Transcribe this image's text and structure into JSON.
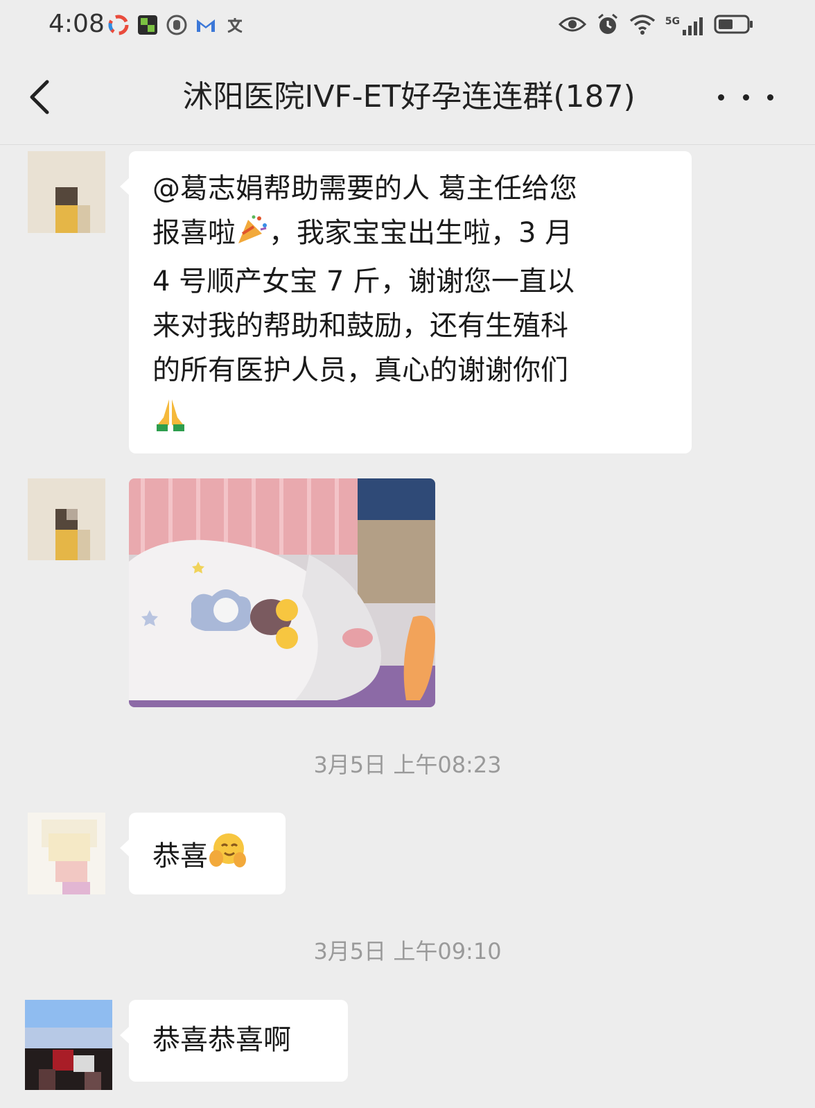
{
  "status_bar": {
    "time": "4:08",
    "left_icons": [
      "cloud-sync-icon",
      "app-green-icon",
      "shield-app-icon",
      "gmail-icon",
      "translate-icon"
    ],
    "right_icons": [
      "eye-icon",
      "alarm-icon",
      "wifi-icon",
      "signal-5g-icon",
      "battery-icon"
    ],
    "network_label": "5G"
  },
  "nav": {
    "title": "沭阳医院IVF-ET好孕连连群(187)",
    "back_icon": "chevron-left-icon",
    "more_icon": "more-icon"
  },
  "messages": [
    {
      "type": "text",
      "lines": [
        "@葛志娟帮助需要的人  葛主任给您",
        "报喜啦",
        "，我家宝宝出生啦，3 月",
        "4 号顺产女宝 7 斤，谢谢您一直以",
        "来对我的帮助和鼓励，还有生殖科",
        "的所有医护人员，真心的谢谢你们"
      ],
      "emojis": [
        "party-popper-icon",
        "folded-hands-icon"
      ]
    },
    {
      "type": "image",
      "description_icon": "baby-photo"
    },
    {
      "type": "timestamp",
      "text": "3月5日 上午08:23"
    },
    {
      "type": "text",
      "text": "恭喜",
      "emoji": "hugging-face-icon"
    },
    {
      "type": "timestamp",
      "text": "3月5日 上午09:10"
    },
    {
      "type": "text",
      "text": "恭喜恭喜啊"
    }
  ],
  "colors": {
    "background": "#ededed",
    "bubble": "#ffffff",
    "timestamp": "#9a9a9a"
  }
}
